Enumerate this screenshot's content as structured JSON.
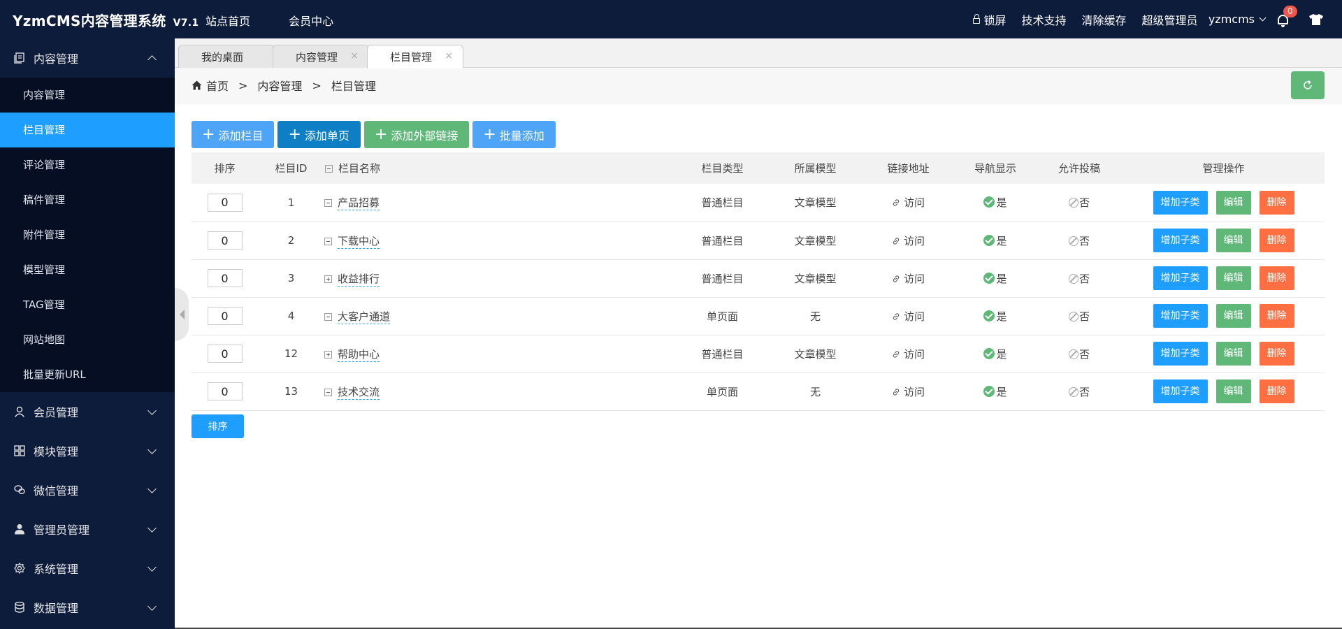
{
  "header": {
    "logo": "YzmCMS内容管理系统",
    "version": "V7.1",
    "nav": [
      "站点首页",
      "会员中心"
    ],
    "lock_label": "锁屏",
    "support_label": "技术支持",
    "clear_cache_label": "清除缓存",
    "role_label": "超级管理员",
    "username": "yzmcms",
    "notification_count": "0"
  },
  "sidebar": {
    "groups": [
      {
        "label": "内容管理",
        "icon": "content-icon",
        "expanded": true
      },
      {
        "label": "会员管理",
        "icon": "user-icon"
      },
      {
        "label": "模块管理",
        "icon": "grid-icon"
      },
      {
        "label": "微信管理",
        "icon": "wechat-icon"
      },
      {
        "label": "管理员管理",
        "icon": "admin-icon"
      },
      {
        "label": "系统管理",
        "icon": "gear-icon"
      },
      {
        "label": "数据管理",
        "icon": "database-icon"
      }
    ],
    "items": [
      "内容管理",
      "栏目管理",
      "评论管理",
      "稿件管理",
      "附件管理",
      "模型管理",
      "TAG管理",
      "网站地图",
      "批量更新URL"
    ],
    "active_item": "栏目管理"
  },
  "tabs": [
    {
      "label": "我的桌面"
    },
    {
      "label": "内容管理",
      "close": "×"
    },
    {
      "label": "栏目管理",
      "close": "×",
      "active": true
    }
  ],
  "breadcrumb": {
    "home": "首页",
    "sep": ">",
    "items": [
      "内容管理",
      "栏目管理"
    ]
  },
  "actions": [
    {
      "label": "添加栏目",
      "color": "#1e9fff"
    },
    {
      "label": "添加单页",
      "color": "#0e7fc4"
    },
    {
      "label": "添加外部链接",
      "color": "#5fb878"
    },
    {
      "label": "批量添加",
      "color": "#1e9fff"
    }
  ],
  "table": {
    "headers": [
      "排序",
      "栏目ID",
      "栏目名称",
      "栏目类型",
      "所属模型",
      "链接地址",
      "导航显示",
      "允许投稿",
      "管理操作"
    ],
    "rows": [
      {
        "sort": "0",
        "id": "1",
        "name": "产品招募",
        "toggle": "minus",
        "type": "普通栏目",
        "model": "文章模型",
        "link": "访问",
        "nav": "是",
        "contrib": "否"
      },
      {
        "sort": "0",
        "id": "2",
        "name": "下载中心",
        "toggle": "minus",
        "type": "普通栏目",
        "model": "文章模型",
        "link": "访问",
        "nav": "是",
        "contrib": "否"
      },
      {
        "sort": "0",
        "id": "3",
        "name": "收益排行",
        "toggle": "plus",
        "type": "普通栏目",
        "model": "文章模型",
        "link": "访问",
        "nav": "是",
        "contrib": "否"
      },
      {
        "sort": "0",
        "id": "4",
        "name": "大客户通道",
        "toggle": "minus",
        "type": "单页面",
        "model": "无",
        "link": "访问",
        "nav": "是",
        "contrib": "否"
      },
      {
        "sort": "0",
        "id": "12",
        "name": "帮助中心",
        "toggle": "plus",
        "type": "普通栏目",
        "model": "文章模型",
        "link": "访问",
        "nav": "是",
        "contrib": "否"
      },
      {
        "sort": "0",
        "id": "13",
        "name": "技术交流",
        "toggle": "minus",
        "type": "单页面",
        "model": "无",
        "link": "访问",
        "nav": "是",
        "contrib": "否"
      }
    ],
    "ops": {
      "add": "增加子类",
      "edit": "编辑",
      "delete": "删除"
    }
  },
  "sort_button": "排序"
}
